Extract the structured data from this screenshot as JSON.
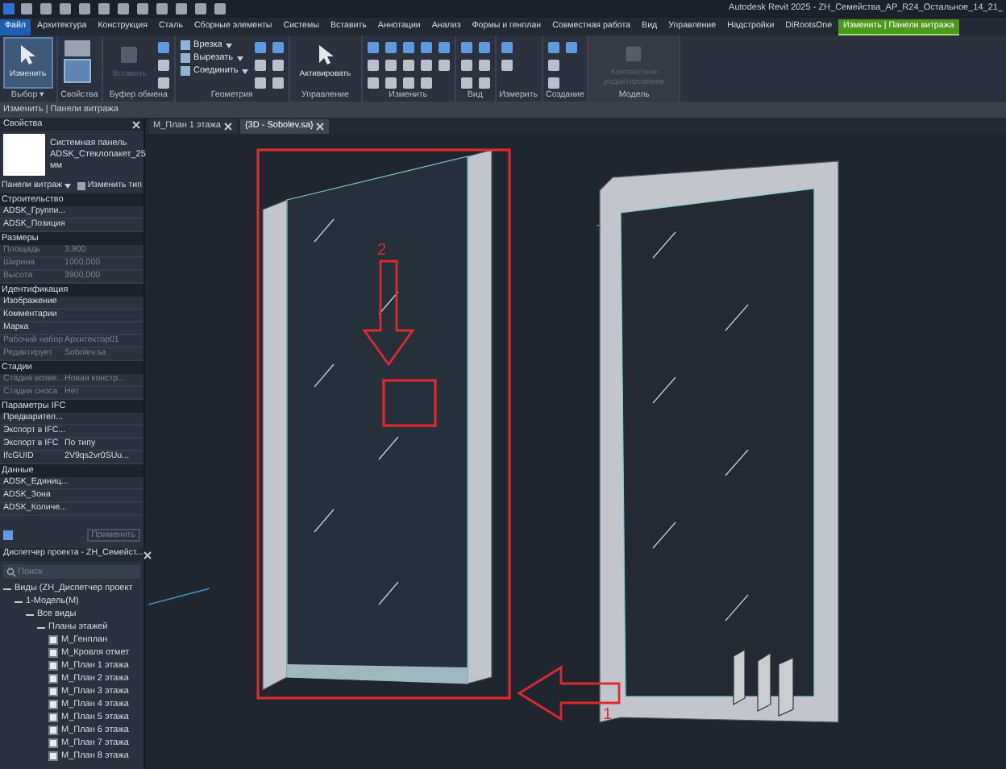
{
  "title": "Autodesk Revit 2025 - ZH_Семейства_АР_R24_Остальное_14_21_",
  "ribbon_tabs": [
    {
      "label": "Файл",
      "kind": "file",
      "selected": false
    },
    {
      "label": "Архитектура",
      "kind": "normal",
      "selected": false
    },
    {
      "label": "Конструкция",
      "kind": "normal",
      "selected": false
    },
    {
      "label": "Сталь",
      "kind": "normal",
      "selected": false
    },
    {
      "label": "Сборные элементы",
      "kind": "normal",
      "selected": false
    },
    {
      "label": "Системы",
      "kind": "normal",
      "selected": false
    },
    {
      "label": "Вставить",
      "kind": "normal",
      "selected": false
    },
    {
      "label": "Аннотации",
      "kind": "normal",
      "selected": false
    },
    {
      "label": "Анализ",
      "kind": "normal",
      "selected": false
    },
    {
      "label": "Формы и генплан",
      "kind": "normal",
      "selected": false
    },
    {
      "label": "Совместная работа",
      "kind": "normal",
      "selected": false
    },
    {
      "label": "Вид",
      "kind": "normal",
      "selected": false
    },
    {
      "label": "Управление",
      "kind": "normal",
      "selected": false
    },
    {
      "label": "Надстройки",
      "kind": "normal",
      "selected": false
    },
    {
      "label": "DiRootsOne",
      "kind": "normal",
      "selected": false
    },
    {
      "label": "Изменить | Панели витража",
      "kind": "contextual",
      "selected": true
    }
  ],
  "ribbon_groups": [
    {
      "label": "Выбор ▾",
      "tools": [
        {
          "label": "Изменить",
          "kind": "large",
          "selected": true,
          "disabled": false
        }
      ]
    },
    {
      "label": "Свойства"
    },
    {
      "label": "Буфер обмена",
      "tools": [
        {
          "label": "Вставить",
          "kind": "large",
          "selected": false,
          "disabled": true
        }
      ]
    },
    {
      "label": "Геометрия",
      "tools": [
        {
          "label": "Врезка",
          "kind": "small",
          "selected": false,
          "disabled": false
        },
        {
          "label": "Вырезать",
          "kind": "small",
          "selected": false,
          "disabled": false
        },
        {
          "label": "Соединить",
          "kind": "small",
          "selected": false,
          "disabled": false
        }
      ]
    },
    {
      "label": "Управление",
      "tools": [
        {
          "label": "Активировать",
          "kind": "large",
          "selected": false,
          "disabled": false
        }
      ]
    },
    {
      "label": "Изменить"
    },
    {
      "label": "Вид"
    },
    {
      "label": "Измерить"
    },
    {
      "label": "Создание"
    },
    {
      "label": "Модель",
      "tools": [
        {
          "label": "Контекстное редактирование",
          "kind": "large",
          "selected": false,
          "disabled": true
        }
      ]
    }
  ],
  "context_bar": "Изменить | Панели витража",
  "properties": {
    "title": "Свойства",
    "type_name": "Системная панель ADSK_Стеклопакет_25 мм",
    "filter": "Панели витраж",
    "edit_type": "Изменить тип",
    "groups": [
      {
        "name": "Строительство",
        "rows": [
          {
            "name": "ADSK_Группи...",
            "disabled": false
          },
          {
            "name": "ADSK_Позиция",
            "disabled": false
          }
        ]
      },
      {
        "name": "Размеры",
        "rows": [
          {
            "name": "Площадь",
            "value": "3,900",
            "disabled": true
          },
          {
            "name": "Ширина",
            "value": "1000,000",
            "disabled": true
          },
          {
            "name": "Высота",
            "value": "3900,000",
            "disabled": true
          }
        ]
      },
      {
        "name": "Идентификация",
        "rows": [
          {
            "name": "Изображение",
            "disabled": false
          },
          {
            "name": "Комментарии",
            "disabled": false
          },
          {
            "name": "Марка",
            "disabled": false
          },
          {
            "name": "Рабочий набор",
            "value": "Архитектор01",
            "disabled": true
          },
          {
            "name": "Редактирует",
            "value": "Sobolev.sa",
            "disabled": true
          }
        ]
      },
      {
        "name": "Стадии",
        "rows": [
          {
            "name": "Стадия возве...",
            "value": "Новая констр...",
            "disabled": true
          },
          {
            "name": "Стадия сноса",
            "value": "Нет",
            "disabled": true
          }
        ]
      },
      {
        "name": "Параметры IFC",
        "rows": [
          {
            "name": "Предварител...",
            "disabled": false
          },
          {
            "name": "Экспорт в IFC...",
            "disabled": false
          },
          {
            "name": "Экспорт в IFC",
            "value": "По типу",
            "disabled": false
          },
          {
            "name": "IfcGUID",
            "value": "2V9qs2vr0SUu...",
            "disabled": false
          }
        ]
      },
      {
        "name": "Данные",
        "rows": [
          {
            "name": "ADSK_Единиц...",
            "disabled": false
          },
          {
            "name": "ADSK_Зона",
            "disabled": false
          },
          {
            "name": "ADSK_Количе...",
            "disabled": false
          }
        ]
      }
    ],
    "apply": "Применить"
  },
  "browser": {
    "title": "Диспетчер проекта - ZH_Семейст...",
    "placeholder": "Поиск",
    "tree": [
      {
        "label": "Виды (ZH_Диспетчер проект",
        "expanded": true,
        "children": [
          {
            "label": "1-Модель(М)",
            "expanded": true,
            "children": [
              {
                "label": "Все виды",
                "expanded": true,
                "children": [
                  {
                    "label": "Планы этажей",
                    "expanded": true,
                    "children": [
                      {
                        "label": "М_Генплан"
                      },
                      {
                        "label": "М_Кровля отмет"
                      },
                      {
                        "label": "М_План 1 этажа"
                      },
                      {
                        "label": "М_План 2 этажа"
                      },
                      {
                        "label": "М_План 3 этажа"
                      },
                      {
                        "label": "М_План 4 этажа"
                      },
                      {
                        "label": "М_План 5 этажа"
                      },
                      {
                        "label": "М_План 6 этажа"
                      },
                      {
                        "label": "М_План 7 этажа"
                      },
                      {
                        "label": "М_План 8 этажа"
                      }
                    ]
                  }
                ]
              }
            ]
          }
        ]
      }
    ]
  },
  "view_tabs": [
    {
      "label": "М_План 1 этажа",
      "selected": false
    },
    {
      "label": "{3D - Sobolev.sa}",
      "selected": true
    }
  ],
  "annotations": [
    {
      "label": "1"
    },
    {
      "label": "2"
    }
  ]
}
